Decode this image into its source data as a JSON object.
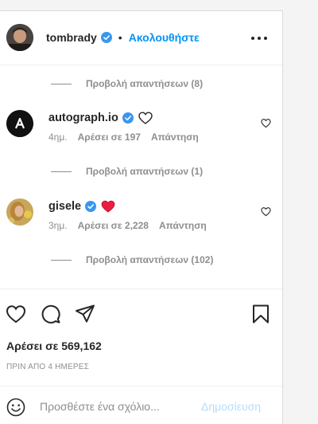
{
  "post": {
    "author": "tombrady",
    "follow_label": "Ακολουθήστε",
    "dot": "•"
  },
  "replies": [
    {
      "label": "Προβολή απαντήσεων (8)"
    },
    {
      "label": "Προβολή απαντήσεων (1)"
    },
    {
      "label": "Προβολή απαντήσεων (102)"
    }
  ],
  "comments": [
    {
      "username": "autograph.io",
      "time": "4ημ.",
      "likes": "Αρέσει σε 197",
      "reply_label": "Απάντηση",
      "emoji": "white-heart"
    },
    {
      "username": "gisele",
      "time": "3ημ.",
      "likes": "Αρέσει σε 2,228",
      "reply_label": "Απάντηση",
      "emoji": "red-heart"
    }
  ],
  "likes_text": "Αρέσει σε 569,162",
  "timestamp": "ΠΡΙΝ ΑΠΟ 4 ΗΜΕΡΕΣ",
  "comment_box": {
    "placeholder": "Προσθέστε ένα σχόλιο...",
    "post_label": "Δημοσίευση"
  },
  "colors": {
    "accent": "#0095f6",
    "verified": "#3897f0",
    "muted": "#8e8e8e",
    "heart_red": "#ed1c40"
  }
}
